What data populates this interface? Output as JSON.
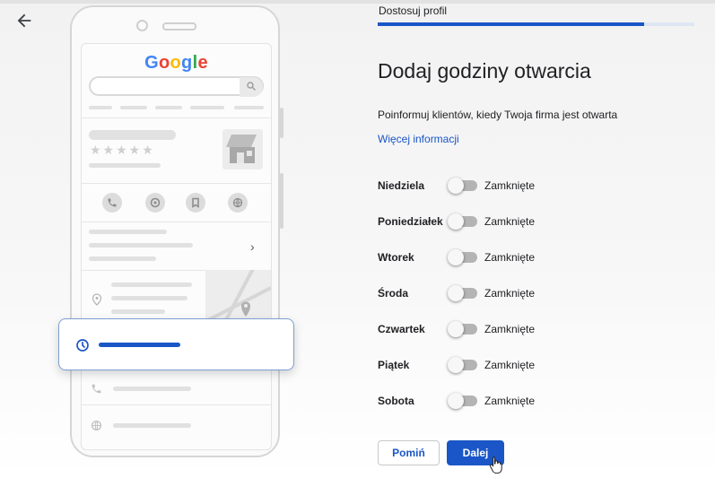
{
  "header": {
    "back_label": "back",
    "step_label": "Dostosuj profil",
    "progress": 0.84
  },
  "illustration": {
    "logo_text": "Google",
    "logo_colors": [
      "#4285F4",
      "#EA4335",
      "#FBBC05",
      "#4285F4",
      "#34A853",
      "#EA4335"
    ],
    "rating_stars": "★★★★★",
    "accent": "#1a56c7"
  },
  "main": {
    "title": "Dodaj godziny otwarcia",
    "subtitle": "Poinformuj klientów, kiedy Twoja firma jest otwarta",
    "more_link": "Więcej informacji",
    "days": [
      {
        "name": "Niedziela",
        "state": "Zamknięte"
      },
      {
        "name": "Poniedziałek",
        "state": "Zamknięte"
      },
      {
        "name": "Wtorek",
        "state": "Zamknięte"
      },
      {
        "name": "Środa",
        "state": "Zamknięte"
      },
      {
        "name": "Czwartek",
        "state": "Zamknięte"
      },
      {
        "name": "Piątek",
        "state": "Zamknięte"
      },
      {
        "name": "Sobota",
        "state": "Zamknięte"
      }
    ]
  },
  "buttons": {
    "skip_label": "Pomiń",
    "next_label": "Dalej"
  }
}
